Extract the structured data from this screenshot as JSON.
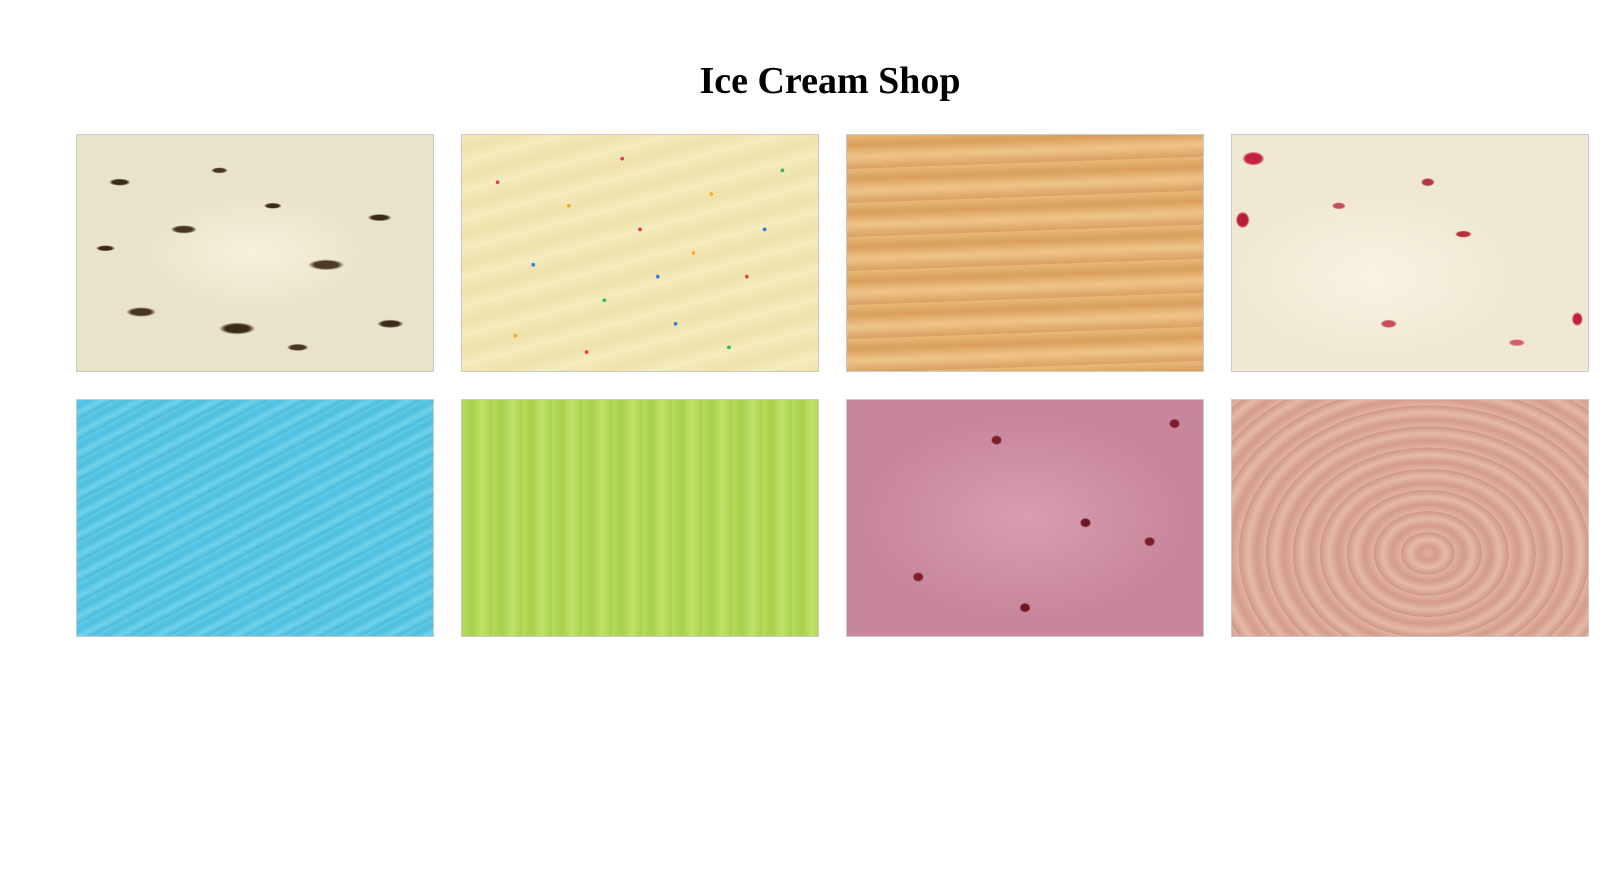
{
  "page": {
    "title": "Ice Cream Shop"
  },
  "gallery": {
    "items": [
      {
        "name": "cookies-and-cream-flavor",
        "color": "#ece6cc"
      },
      {
        "name": "vanilla-sprinkles-flavor",
        "color": "#f1e6b3"
      },
      {
        "name": "caramel-flavor",
        "color": "#e2ad6c"
      },
      {
        "name": "cherry-vanilla-flavor",
        "color": "#f3ecd9"
      },
      {
        "name": "blue-flavor",
        "color": "#58c3e2"
      },
      {
        "name": "lime-flavor",
        "color": "#b4d857"
      },
      {
        "name": "raspberry-flavor",
        "color": "#cf93a6"
      },
      {
        "name": "chocolate-flavor",
        "color": "#dcaa9a"
      }
    ]
  }
}
